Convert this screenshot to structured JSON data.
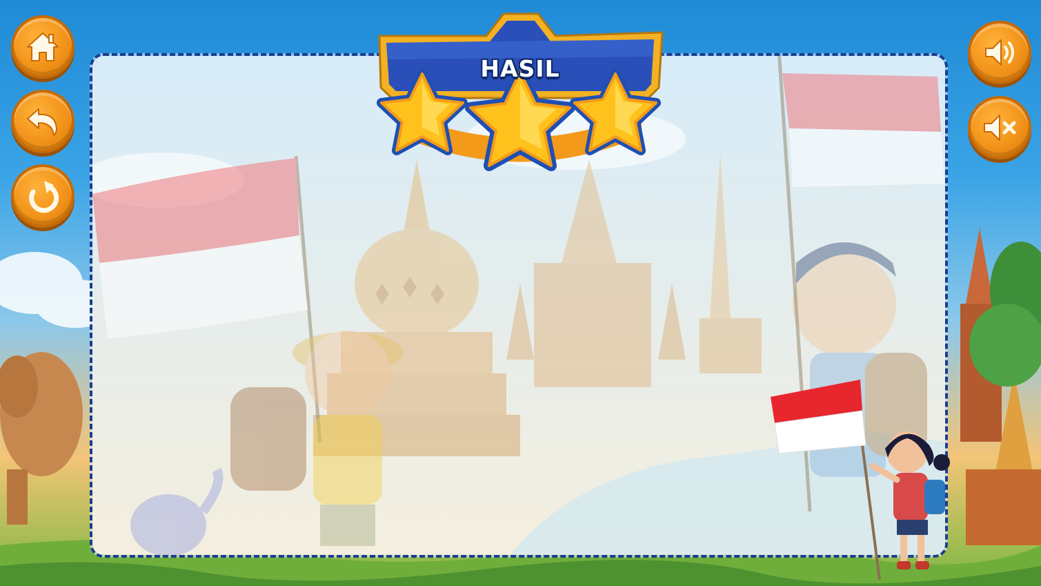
{
  "banner": {
    "title": "HASIL"
  },
  "result": {
    "stars_earned": 3,
    "stars_total": 3
  },
  "buttons": {
    "home_icon": "home-icon",
    "back_icon": "undo-arrow-icon",
    "restart_icon": "restart-icon",
    "sound_on_icon": "speaker-on-icon",
    "sound_off_icon": "speaker-mute-icon"
  },
  "colors": {
    "button_orange": "#f2931a",
    "banner_blue": "#2a4fb8",
    "banner_gold": "#f3b224",
    "star_yellow": "#ffd02a",
    "board_border": "#1b3d8f",
    "flag_red": "#e8262e",
    "flag_white": "#ffffff"
  }
}
